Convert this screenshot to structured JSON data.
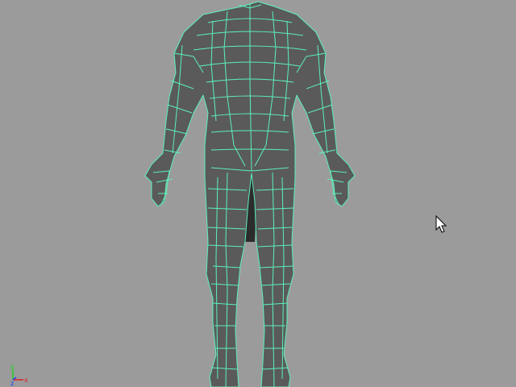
{
  "viewport": {
    "background": "#9b9b9b",
    "mesh_fill": "#5a5a5a",
    "mesh_fill_dark": "#2c2c2c",
    "wire_color": "#5cf0b8",
    "cursor_icon": "arrow-cursor-icon"
  },
  "axis_gizmo": {
    "x_label": "x",
    "y_label": "y",
    "z_label": "z",
    "x_color": "#e02020",
    "y_color": "#20d020",
    "z_color": "#2040ff"
  }
}
